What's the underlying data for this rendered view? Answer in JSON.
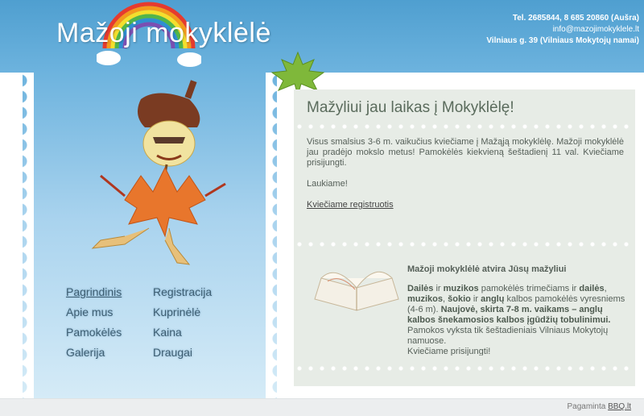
{
  "brand": {
    "logo_text": "Mažoji mokyklėlė"
  },
  "contact": {
    "phone": "Tel. 2685844, 8 685 20860 (Aušra)",
    "email": "info@mazojimokyklele.lt",
    "address": "Vilniaus g. 39 (Vilniaus Mokytojų namai)"
  },
  "nav": {
    "items": [
      {
        "label": "Pagrindinis"
      },
      {
        "label": "Registracija"
      },
      {
        "label": "Apie mus"
      },
      {
        "label": "Kuprinėlė"
      },
      {
        "label": "Pamokėlės"
      },
      {
        "label": "Kaina"
      },
      {
        "label": "Galerija"
      },
      {
        "label": "Draugai"
      }
    ]
  },
  "content": {
    "title": "Mažyliui jau laikas į Mokyklėlę!",
    "para1": "Visus smalsius 3-6 m. vaikučius kviečiame  į Mažąją mokyklėlę. Mažoji mokyklėlė jau pradėjo mokslo metus! Pamokėlės kiekvieną šeštadienį 11 val.  Kviečiame prisijungti.",
    "para2": "Laukiame!",
    "register_link": "Kviečiame registruotis"
  },
  "promo": {
    "title": "Mažoji  mokyklėlė atvira Jūsų mažyliui",
    "b_daile": "Dailės",
    "t_ir1": " ir ",
    "b_muzikos": "muzikos",
    "t_mid": " pamokėlės trimečiams ir ",
    "b_dailes2": "dailės",
    "t_comma": ", ",
    "b_muzikos2": "muzikos",
    "t_comma2": ", ",
    "b_sokio": "šokio",
    "t_ir2": " ir ",
    "b_anglu": "anglų",
    "t_after": " kalbos pamokėlės vyresniems (4-6 m). ",
    "b_naujove": "Naujovė, skirta 7-8 m. vaikams – anglų kalbos šnekamosios kalbos įgūdžių tobulinimui.",
    "t_tail": "  Pamokos vyksta tik šeštadieniais Vilniaus Mokytojų namuose.",
    "t_join": "Kviečiame prisijungti!"
  },
  "footer": {
    "made_by": "Pagaminta",
    "made_by_link": "BBQ.lt"
  },
  "colors": {
    "header": "#4f9fd0",
    "content_bg": "#e7ece6",
    "text": "#555f58"
  }
}
